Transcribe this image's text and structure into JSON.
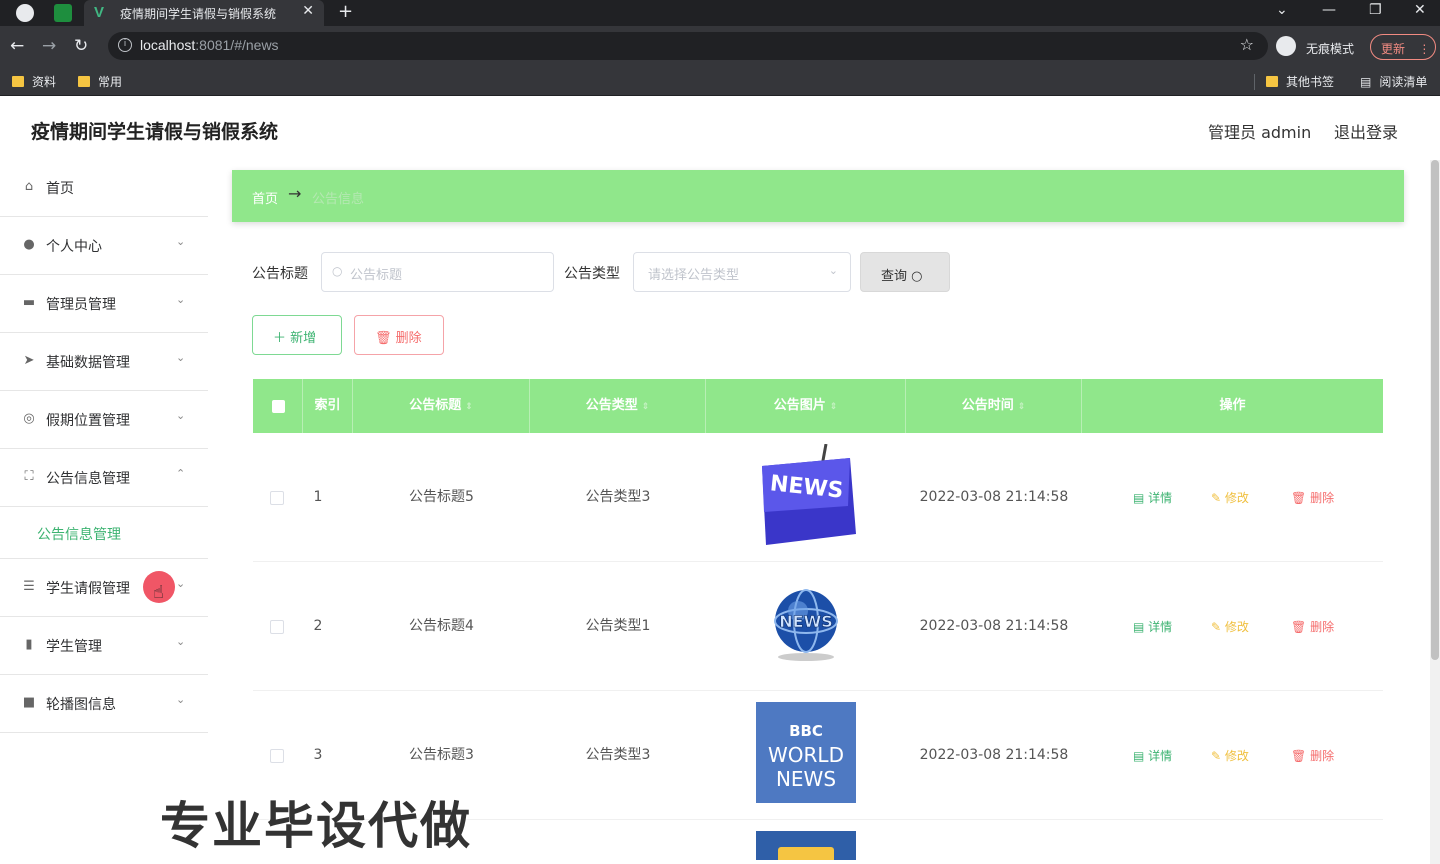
{
  "browser": {
    "tab_title": "疫情期间学生请假与销假系统",
    "url_host": "localhost",
    "url_path": ":8081/#/news",
    "incognito_label": "无痕模式",
    "update_label": "更新",
    "bookmarks": [
      "资料",
      "常用"
    ],
    "bookmarks_right": [
      "其他书签",
      "阅读清单"
    ]
  },
  "header": {
    "title": "疫情期间学生请假与销假系统",
    "admin": "管理员 admin",
    "logout": "退出登录"
  },
  "sidebar": {
    "items": [
      {
        "label": "首页",
        "icon": "home-icon"
      },
      {
        "label": "个人中心",
        "icon": "user-icon"
      },
      {
        "label": "管理员管理",
        "icon": "admin-icon"
      },
      {
        "label": "基础数据管理",
        "icon": "paper-plane-icon"
      },
      {
        "label": "假期位置管理",
        "icon": "location-icon"
      },
      {
        "label": "公告信息管理",
        "icon": "notice-icon"
      },
      {
        "label": "学生请假管理",
        "icon": "sliders-icon"
      },
      {
        "label": "学生管理",
        "icon": "bar-chart-icon"
      },
      {
        "label": "轮播图信息",
        "icon": "video-icon"
      }
    ],
    "submenu": {
      "label": "公告信息管理"
    }
  },
  "breadcrumb": {
    "home": "首页",
    "current": "公告信息"
  },
  "search": {
    "title_label": "公告标题",
    "title_placeholder": "公告标题",
    "type_label": "公告类型",
    "type_placeholder": "请选择公告类型",
    "query_label": "查询"
  },
  "actions": {
    "add": "新增",
    "delete": "删除"
  },
  "table": {
    "columns": [
      "索引",
      "公告标题",
      "公告类型",
      "公告图片",
      "公告时间",
      "操作"
    ],
    "rows": [
      {
        "index": "1",
        "title": "公告标题5",
        "type": "公告类型3",
        "image": "news-keyboard",
        "time": "2022-03-08 21:14:58"
      },
      {
        "index": "2",
        "title": "公告标题4",
        "type": "公告类型1",
        "image": "news-globe",
        "time": "2022-03-08 21:14:58"
      },
      {
        "index": "3",
        "title": "公告标题3",
        "type": "公告类型3",
        "image": "bbc-world-news",
        "time": "2022-03-08 21:14:58"
      }
    ],
    "row_actions": {
      "detail": "详情",
      "edit": "修改",
      "delete": "删除"
    },
    "bbc_text": {
      "line1": "BBC",
      "line2": "WORLD",
      "line3": "NEWS"
    },
    "news_text": "NEWS"
  },
  "watermark": "专业毕设代做",
  "colors": {
    "accent": "#90e78b",
    "green_text": "#3cb371",
    "danger": "#f56c6c",
    "warning": "#f0c040"
  }
}
